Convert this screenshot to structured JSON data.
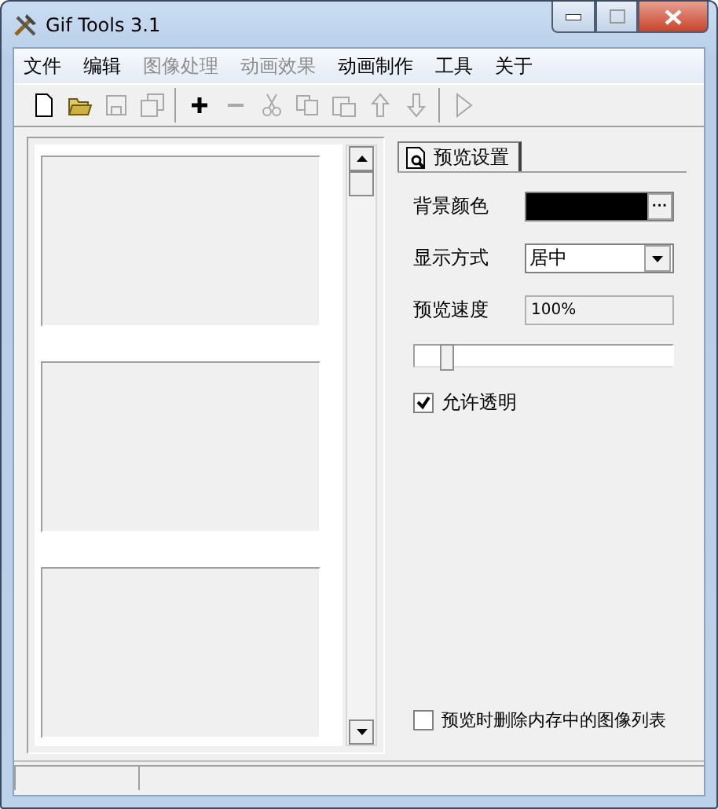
{
  "window": {
    "title": "Gif Tools 3.1"
  },
  "menu": [
    {
      "label": "文件",
      "disabled": false
    },
    {
      "label": "编辑",
      "disabled": false
    },
    {
      "label": "图像处理",
      "disabled": true
    },
    {
      "label": "动画效果",
      "disabled": true
    },
    {
      "label": "动画制作",
      "disabled": false
    },
    {
      "label": "工具",
      "disabled": false
    },
    {
      "label": "关于",
      "disabled": false
    }
  ],
  "toolbar": [
    {
      "buttons": [
        {
          "kind": "new",
          "disabled": false
        },
        {
          "kind": "open",
          "disabled": false
        },
        {
          "kind": "save",
          "disabled": true
        },
        {
          "kind": "save-all",
          "disabled": true
        }
      ]
    },
    {
      "buttons": [
        {
          "kind": "add",
          "disabled": false
        },
        {
          "kind": "remove",
          "disabled": true
        },
        {
          "kind": "cut",
          "disabled": true
        },
        {
          "kind": "copy",
          "disabled": true
        },
        {
          "kind": "paste",
          "disabled": true
        },
        {
          "kind": "up",
          "disabled": true
        },
        {
          "kind": "down",
          "disabled": true
        }
      ]
    },
    {
      "buttons": [
        {
          "kind": "play",
          "disabled": true
        }
      ]
    }
  ],
  "frame_list": {
    "frames": [
      {
        "kind": "empty"
      },
      {
        "kind": "empty"
      },
      {
        "kind": "empty"
      }
    ]
  },
  "settings": {
    "tabs": [
      {
        "label": "预览设置",
        "selected": true
      }
    ],
    "background_color": {
      "label": "背景颜色",
      "color": "#000000",
      "button": "···"
    },
    "display_mode": {
      "label": "显示方式",
      "value": "居中"
    },
    "preview_speed": {
      "label": "预览速度",
      "value": "100%",
      "level": 0.1
    },
    "allow_transparency": {
      "label": "允许透明",
      "checked": true
    },
    "delete_on_preview": {
      "label": "预览时删除内存中的图像列表",
      "checked": false
    }
  }
}
